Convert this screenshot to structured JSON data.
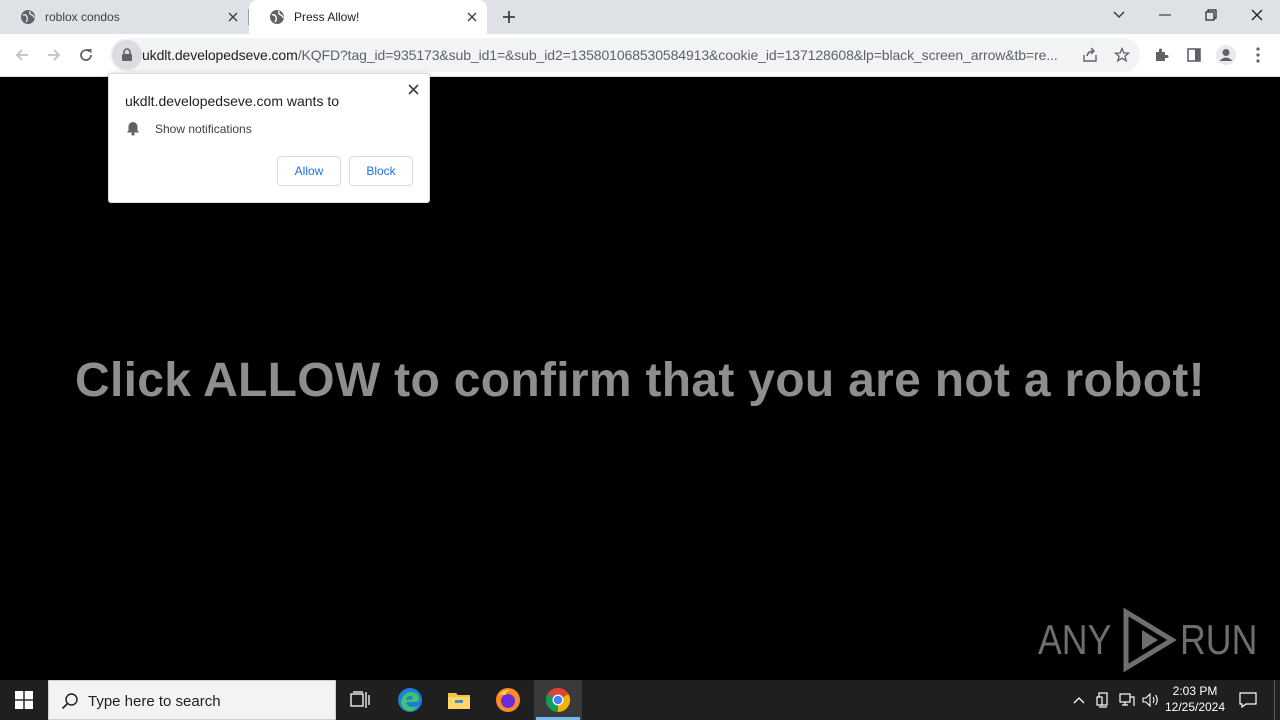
{
  "browser": {
    "tabs": [
      {
        "title": "roblox condos"
      },
      {
        "title": "Press Allow!"
      }
    ],
    "url": {
      "host": "ukdlt.developedseve.com",
      "path": "/KQFD?tag_id=935173&sub_id1=&sub_id2=135801068530584913&cookie_id=137128608&lp=black_screen_arrow&tb=re..."
    }
  },
  "permission_popup": {
    "title": "ukdlt.developedseve.com wants to",
    "item": "Show notifications",
    "allow_label": "Allow",
    "block_label": "Block"
  },
  "page": {
    "headline": "Click ALLOW to confirm that you are not a robot!"
  },
  "watermark": {
    "left": "ANY",
    "right": "RUN"
  },
  "taskbar": {
    "search_placeholder": "Type here to search",
    "time": "2:03 PM",
    "date": "12/25/2024"
  },
  "colors": {
    "headline": "#8e8e8e",
    "page_bg": "#000000",
    "accent_blue": "#1a73e8"
  }
}
